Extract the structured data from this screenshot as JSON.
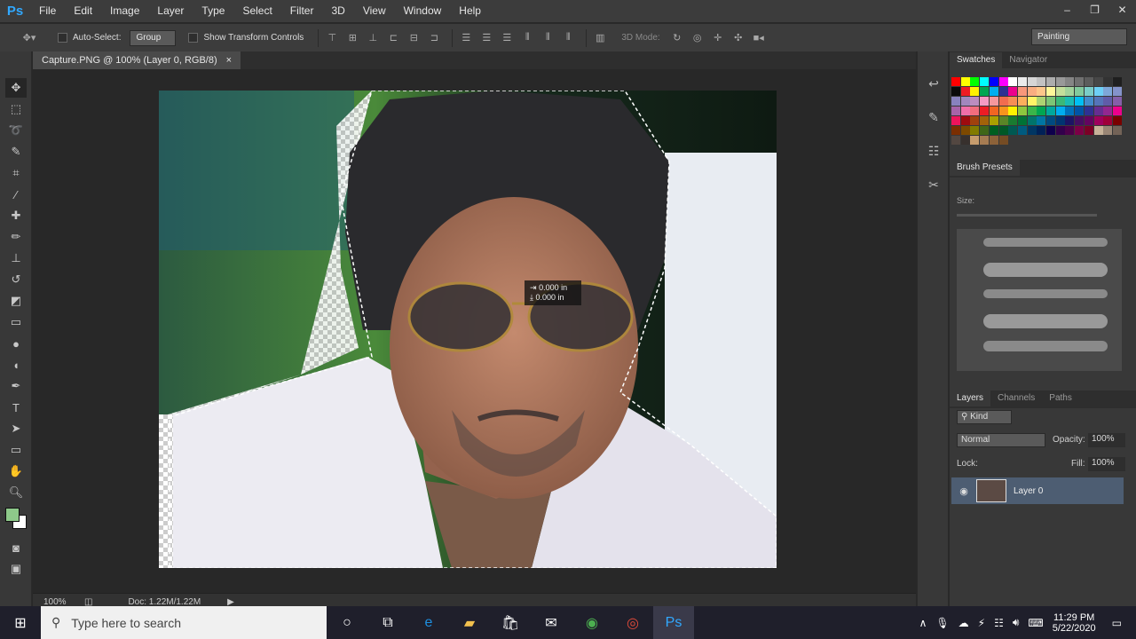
{
  "menubar": {
    "logo": "Ps",
    "items": [
      "File",
      "Edit",
      "Image",
      "Layer",
      "Type",
      "Select",
      "Filter",
      "3D",
      "View",
      "Window",
      "Help"
    ],
    "window_controls": [
      "–",
      "❐",
      "✕"
    ]
  },
  "options": {
    "auto_select_label": "Auto-Select:",
    "auto_select_value": "Group",
    "transform_label": "Show Transform Controls",
    "mode_3d_label": "3D Mode:",
    "workspace": "Painting"
  },
  "document": {
    "tab_title": "Capture.PNG @ 100% (Layer 0, RGB/8)",
    "tab_close": "×",
    "readout_x": "0.000 in",
    "readout_y": "0.000 in",
    "zoom": "100%",
    "doc_size": "Doc: 1.22M/1.22M"
  },
  "swatches_panel": {
    "tabs": [
      "Swatches",
      "Navigator"
    ]
  },
  "brush_panel": {
    "title": "Brush Presets",
    "size_label": "Size:"
  },
  "layers_panel": {
    "tabs": [
      "Layers",
      "Channels",
      "Paths"
    ],
    "kind_label": "Kind",
    "blend_mode": "Normal",
    "opacity_label": "Opacity:",
    "opacity_value": "100%",
    "lock_label": "Lock:",
    "fill_label": "Fill:",
    "fill_value": "100%",
    "layer_name": "Layer 0"
  },
  "taskbar": {
    "search_placeholder": "Type here to search",
    "time": "11:29 PM",
    "date": "5/22/2020"
  },
  "colors": {
    "foreground": "#8ec98a",
    "background": "#ffffff",
    "accent": "#31a8ff"
  }
}
